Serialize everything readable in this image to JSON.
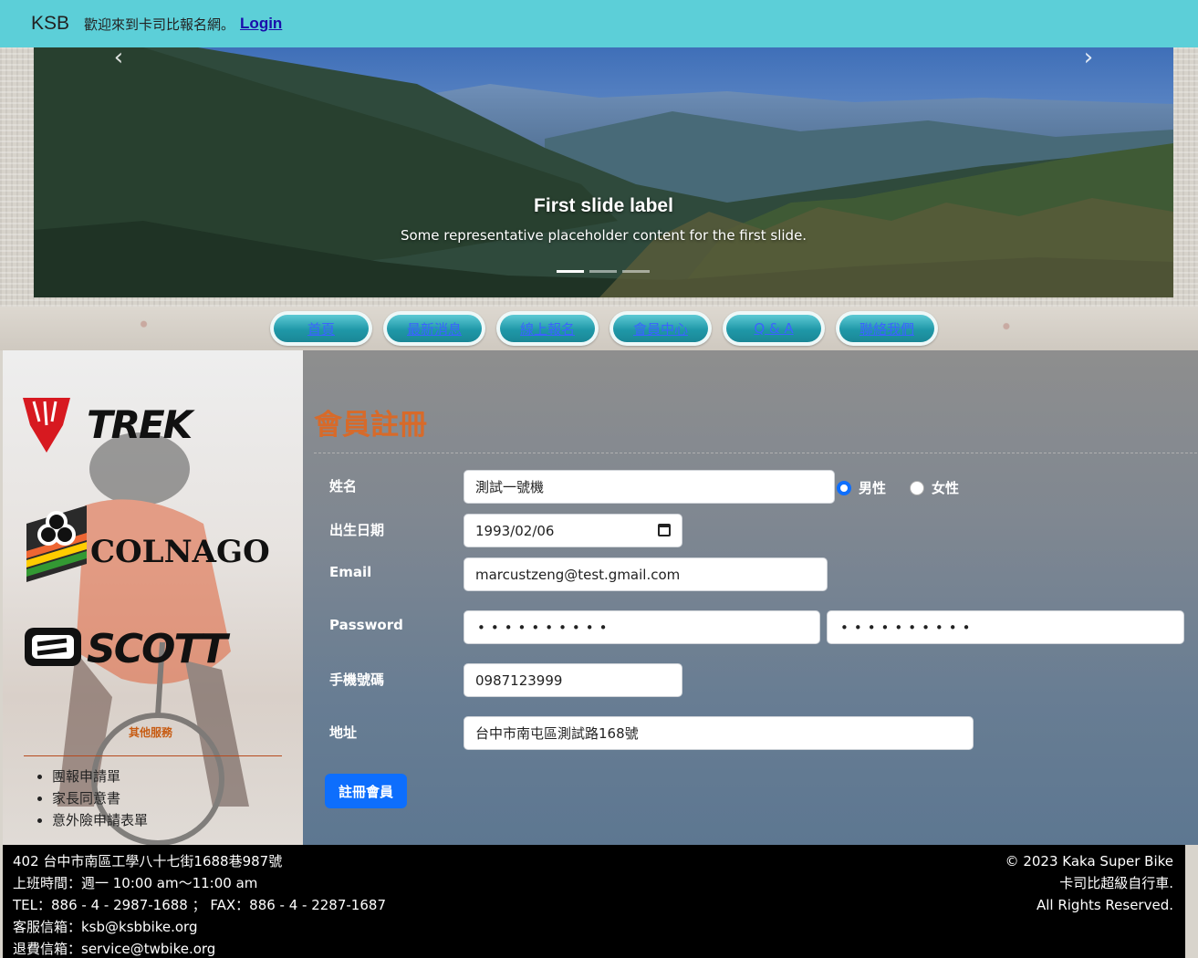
{
  "navbar": {
    "brand": "KSB",
    "welcome": "歡迎來到卡司比報名網。",
    "login_label": "Login"
  },
  "carousel": {
    "title": "First slide label",
    "text": "Some representative placeholder content for the first slide.",
    "slide_count": 3,
    "active_slide": 1,
    "prev_icon": "chevron-left-icon",
    "next_icon": "chevron-right-icon"
  },
  "menu": {
    "items": [
      {
        "label": "首頁"
      },
      {
        "label": "最新消息"
      },
      {
        "label": "線上報名"
      },
      {
        "label": "會員中心"
      },
      {
        "label": "Q & A"
      },
      {
        "label": "聯絡我們"
      }
    ]
  },
  "sidebar": {
    "brands": [
      {
        "name": "TREK",
        "icon": "trek-logo"
      },
      {
        "name": "COLNAGO",
        "icon": "colnago-logo"
      },
      {
        "name": "SCOTT",
        "icon": "scott-logo"
      }
    ],
    "other_title": "其他服務",
    "other_items": [
      "團報申請單",
      "家長同意書",
      "意外險申請表單"
    ]
  },
  "form": {
    "title": "會員註冊",
    "name_label": "姓名",
    "name_value": "測試一號機",
    "gender_options": [
      {
        "label": "男性",
        "checked": true
      },
      {
        "label": "女性",
        "checked": false
      }
    ],
    "birth_label": "出生日期",
    "birth_value": "1993/02/06",
    "email_label": "Email",
    "email_value": "marcustzeng@test.gmail.com",
    "password_label": "Password",
    "password_value": "••••••••••",
    "password_confirm_value": "••••••••••",
    "phone_label": "手機號碼",
    "phone_value": "0987123999",
    "address_label": "地址",
    "address_value": "台中市南屯區測試路168號",
    "submit_label": "註冊會員",
    "accent_color": "#0d6efd",
    "title_color": "#d76a2a"
  },
  "footer": {
    "left": [
      "402 台中市南區工學八十七街1688巷987號",
      "上班時間：週一 10:00 am～11:00 am",
      "TEL：886 - 4 - 2987-1688 ； FAX：886 - 4 - 2287-1687",
      "客服信箱：ksb@ksbbike.org",
      "退費信箱：service@twbike.org"
    ],
    "right": [
      "© 2023 Kaka Super Bike",
      "卡司比超級自行車.",
      "All Rights Reserved."
    ]
  }
}
